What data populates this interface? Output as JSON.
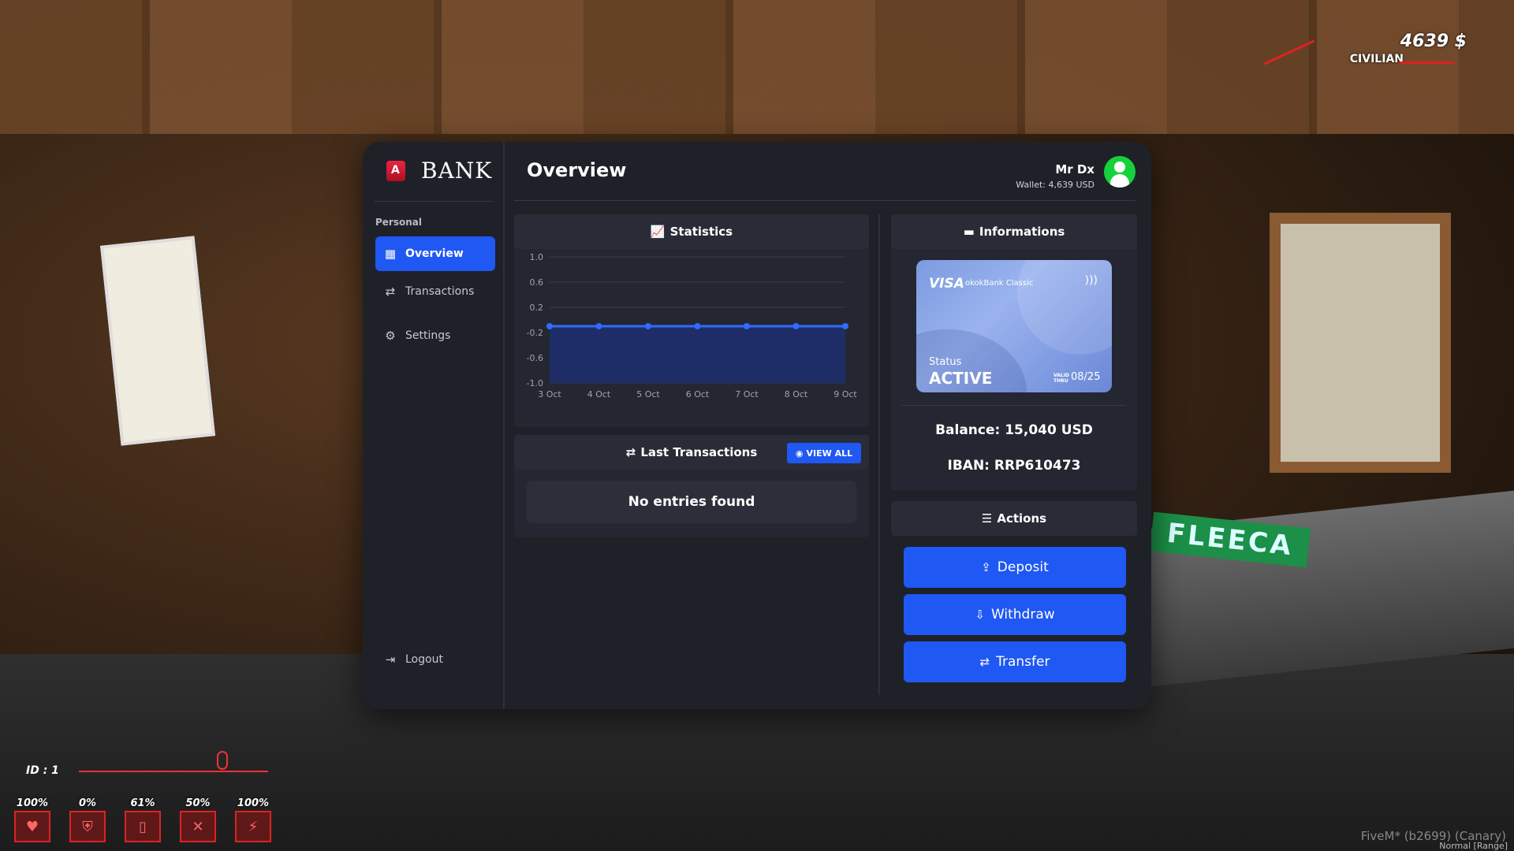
{
  "hud": {
    "money": "4639 $",
    "job": "CIVILIAN",
    "player_id": "ID : 1",
    "stats": [
      "100%",
      "0%",
      "61%",
      "50%",
      "100%"
    ],
    "footer": "FiveM* (b2699) (Canary)",
    "voice_mode": "Normal [Range]"
  },
  "bank": {
    "brand": "BANK",
    "section_label": "Personal",
    "nav": {
      "overview": "Overview",
      "transactions": "Transactions",
      "settings": "Settings",
      "logout": "Logout"
    },
    "page_title": "Overview",
    "user": {
      "name": "Mr Dx",
      "wallet": "Wallet: 4,639 USD"
    },
    "statistics": {
      "title": "Statistics"
    },
    "last_transactions": {
      "title": "Last Transactions",
      "view_all": "VIEW ALL",
      "empty": "No entries found"
    },
    "informations": {
      "title": "Informations",
      "card": {
        "network": "VISA",
        "product": "okokBank Classic",
        "status_label": "Status",
        "status": "ACTIVE",
        "valid_thru_line1": "VALID",
        "valid_thru_line2": "THRU",
        "expiry": "08/25"
      },
      "balance": "Balance: 15,040 USD",
      "iban": "IBAN: RRP610473"
    },
    "actions": {
      "title": "Actions",
      "deposit": "Deposit",
      "withdraw": "Withdraw",
      "transfer": "Transfer"
    }
  },
  "chart_data": {
    "type": "area",
    "categories": [
      "3 Oct",
      "4 Oct",
      "5 Oct",
      "6 Oct",
      "7 Oct",
      "8 Oct",
      "9 Oct"
    ],
    "values": [
      -0.1,
      -0.1,
      -0.1,
      -0.1,
      -0.1,
      -0.1,
      -0.1
    ],
    "yticks": [
      "1.0",
      "0.6",
      "0.2",
      "-0.2",
      "-0.6",
      "-1.0"
    ],
    "ylim": [
      -1.0,
      1.0
    ],
    "grid": true,
    "colors": {
      "line": "#2f6bff",
      "fill": "#1e2e6e"
    }
  }
}
